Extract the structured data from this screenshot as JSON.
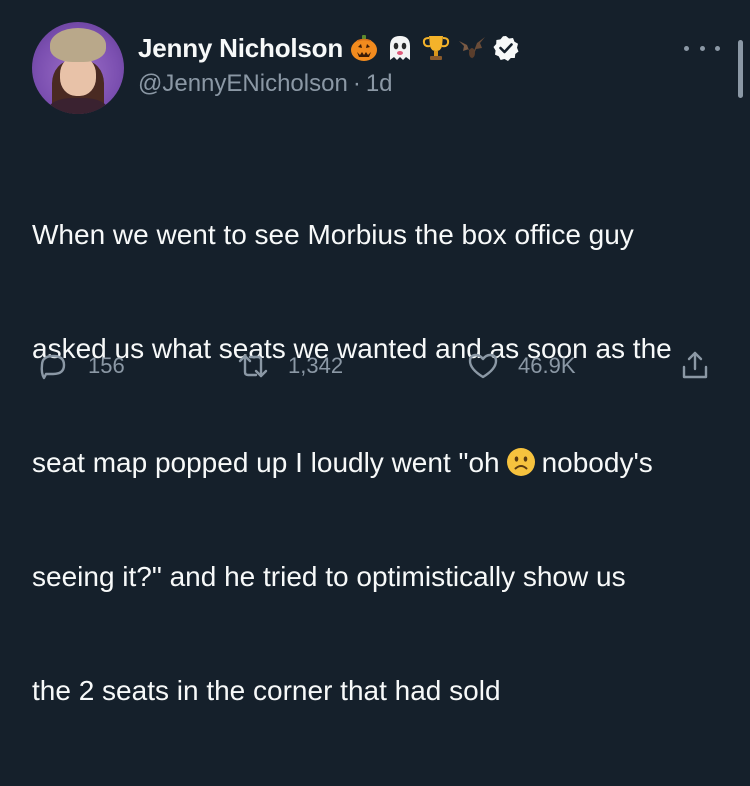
{
  "author": {
    "display_name": "Jenny Nicholson",
    "handle": "@JennyENicholson",
    "separator": "·",
    "time_ago": "1d",
    "name_emojis": [
      "jack-o-lantern-icon",
      "ghost-icon",
      "trophy-icon",
      "bat-icon"
    ],
    "verified": true
  },
  "tweet": {
    "lines": [
      "When we went to see Morbius the box office guy",
      "asked us what seats we wanted and as soon as the",
      "seat map popped up I loudly went \"oh",
      "nobody's",
      "seeing it?\" and he tried to optimistically show us",
      "the 2 seats in the corner that had sold"
    ],
    "inline_emoji": "frowning-face-icon"
  },
  "actions": {
    "reply_count": "156",
    "retweet_count": "1,342",
    "like_count": "46.9K"
  },
  "colors": {
    "background": "#15202b",
    "text": "#f7f9f9",
    "secondary": "#8b98a5",
    "verified": "#f7f9f9"
  }
}
